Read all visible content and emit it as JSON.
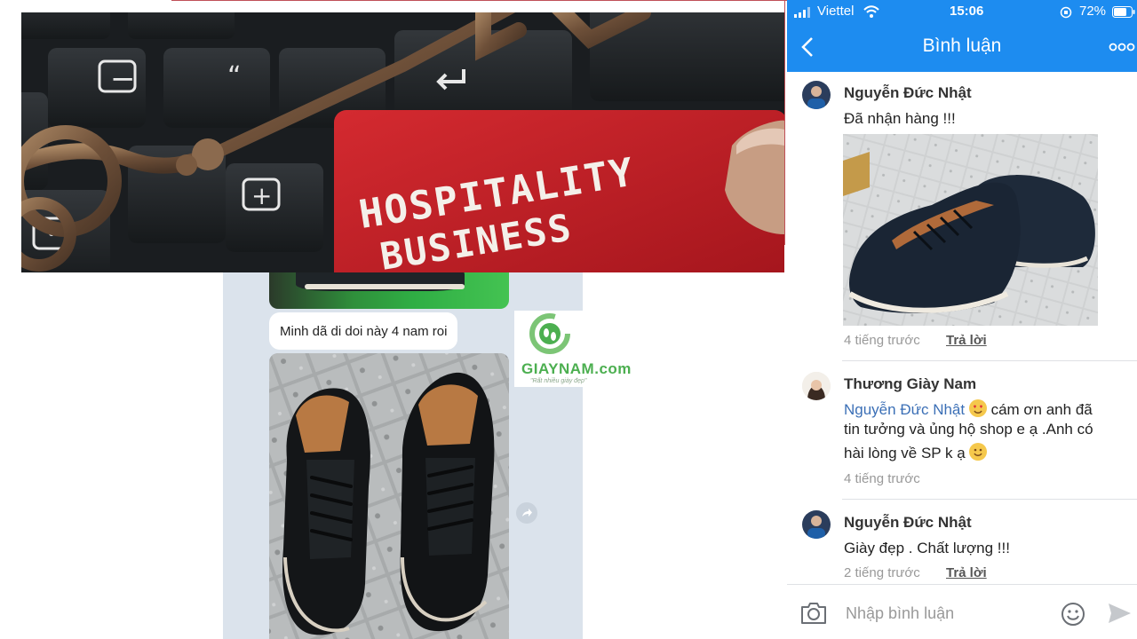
{
  "chat": {
    "message": "Minh dã di doi này 4 nam roi"
  },
  "watermark": {
    "brand": "GIAYNAM.com",
    "slogan": "\"Rất nhiều giày đẹp\""
  },
  "banner": {
    "line1": "HOSPITALITY",
    "line2": "BUSINESS",
    "key_minus": "−",
    "key_plus": "+",
    "key_quote": "“"
  },
  "phone": {
    "status": {
      "carrier": "Viettel",
      "time": "15:06",
      "battery": "72%"
    },
    "nav": {
      "title": "Bình luận"
    },
    "comments": [
      {
        "author": "Nguyễn Đức Nhật",
        "text": "Đã nhận hàng !!!",
        "time": "4 tiếng trước",
        "reply": "Trả lời"
      },
      {
        "author": "Thương Giày Nam",
        "mention": "Nguyễn Đức Nhật",
        "text_line1": " cám ơn anh đã",
        "text_line2": "tin tưởng và ủng hộ shop e ạ .Anh có",
        "text_line3": "hài lòng về SP k ạ",
        "time": "4 tiếng trước"
      },
      {
        "author": "Nguyễn Đức Nhật",
        "text": "Giày đẹp . Chất lượng !!!",
        "time": "2 tiếng trước",
        "reply": "Trả lời"
      }
    ],
    "composer": {
      "placeholder": "Nhập bình luận"
    }
  },
  "colors": {
    "facebook_blue": "#1d8cf0",
    "banner_red_key": "#c8202a",
    "mention_blue": "#3b6fb6",
    "logo_green": "#4caf50"
  }
}
